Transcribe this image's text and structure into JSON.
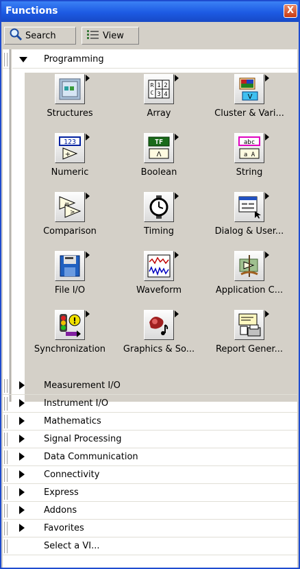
{
  "window": {
    "title": "Functions",
    "close_label": "X"
  },
  "toolbar": {
    "search_label": "Search",
    "view_label": "View"
  },
  "programming": {
    "label": "Programming",
    "items": [
      {
        "label": "Structures",
        "icon": "structures-icon"
      },
      {
        "label": "Array",
        "icon": "array-icon"
      },
      {
        "label": "Cluster & Vari...",
        "icon": "cluster-icon"
      },
      {
        "label": "Numeric",
        "icon": "numeric-icon"
      },
      {
        "label": "Boolean",
        "icon": "boolean-icon"
      },
      {
        "label": "String",
        "icon": "string-icon"
      },
      {
        "label": "Comparison",
        "icon": "comparison-icon"
      },
      {
        "label": "Timing",
        "icon": "timing-icon"
      },
      {
        "label": "Dialog & User...",
        "icon": "dialog-icon"
      },
      {
        "label": "File I/O",
        "icon": "file-io-icon"
      },
      {
        "label": "Waveform",
        "icon": "waveform-icon"
      },
      {
        "label": "Application C...",
        "icon": "application-control-icon"
      },
      {
        "label": "Synchronization",
        "icon": "synchronization-icon"
      },
      {
        "label": "Graphics & So...",
        "icon": "graphics-sound-icon"
      },
      {
        "label": "Report Gener...",
        "icon": "report-generation-icon"
      }
    ]
  },
  "icon_glyphs": {
    "array": [
      "R",
      "1",
      "2",
      "C",
      "3",
      "4"
    ],
    "numeric": "123",
    "boolean": "TF",
    "string_top": "abc",
    "string_bottom": "a A"
  },
  "categories": [
    {
      "label": "Measurement I/O"
    },
    {
      "label": "Instrument I/O"
    },
    {
      "label": "Mathematics"
    },
    {
      "label": "Signal Processing"
    },
    {
      "label": "Data Communication"
    },
    {
      "label": "Connectivity"
    },
    {
      "label": "Express"
    },
    {
      "label": "Addons"
    },
    {
      "label": "Favorites"
    },
    {
      "label": "Select a VI..."
    }
  ]
}
